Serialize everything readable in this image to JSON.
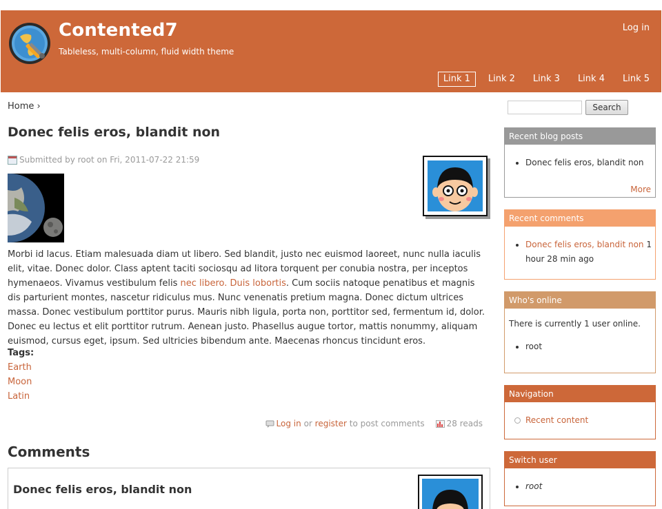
{
  "header": {
    "site_name": "Contented7",
    "slogan": "Tableless, multi-column, fluid width theme",
    "login_label": "Log in",
    "primary_links": [
      "Link 1",
      "Link 2",
      "Link 3",
      "Link 4",
      "Link 5"
    ],
    "active_link_index": 0,
    "background_color": "#cd6839"
  },
  "breadcrumb": {
    "home_label": "Home",
    "separator": "›"
  },
  "node": {
    "title": "Donec felis eros, blandit non",
    "submitted": "Submitted by root on Fri, 2011-07-22 21:59",
    "body_before_link": "Morbi id lacus. Etiam malesuada diam ut libero. Sed blandit, justo nec euismod laoreet, nunc nulla iaculis elit, vitae. Donec dolor. Class aptent taciti sociosqu ad litora torquent per conubia nostra, per inceptos hymenaeos. Vivamus vestibulum felis ",
    "body_link": "nec libero. Duis lobortis",
    "body_after_link": ". Cum sociis natoque penatibus et magnis dis parturient montes, nascetur ridiculus mus. Nunc venenatis pretium magna. Donec dictum ultrices massa. Donec vestibulum porttitor purus. Mauris nibh ligula, porta non, porttitor sed, fermentum id, dolor. Donec eu lectus et elit porttitor rutrum. Aenean justo. Phasellus augue tortor, mattis nonummy, aliquam euismod, cursus eget, ipsum. Sed ultricies bibendum ante. Maecenas rhoncus tincidunt eros.",
    "tags_label": "Tags:",
    "tags": [
      "Earth",
      "Moon",
      "Latin"
    ],
    "links": {
      "login": "Log in",
      "or": "or",
      "register": "register",
      "to_post": "to post comments",
      "reads": "28 reads"
    }
  },
  "comments": {
    "heading": "Comments",
    "items": [
      {
        "title": "Donec felis eros, blandit non"
      }
    ]
  },
  "sidebar": {
    "search_button": "Search",
    "search_value": "",
    "blocks": {
      "recent_blog_posts": {
        "title": "Recent blog posts",
        "items": [
          "Donec felis eros, blandit non"
        ],
        "more": "More",
        "color": "#999999"
      },
      "recent_comments": {
        "title": "Recent comments",
        "item_link": "Donec felis eros, blandit non",
        "item_time": "1 hour 28 min ago",
        "color": "#f4a16e"
      },
      "whos_online": {
        "title": "Who's online",
        "text": "There is currently 1 user online.",
        "users": [
          "root"
        ],
        "color": "#d19a6a"
      },
      "navigation": {
        "title": "Navigation",
        "items": [
          "Recent content"
        ],
        "color": "#cd6839"
      },
      "switch_user": {
        "title": "Switch user",
        "items": [
          "root"
        ],
        "color": "#cd6839"
      }
    }
  }
}
